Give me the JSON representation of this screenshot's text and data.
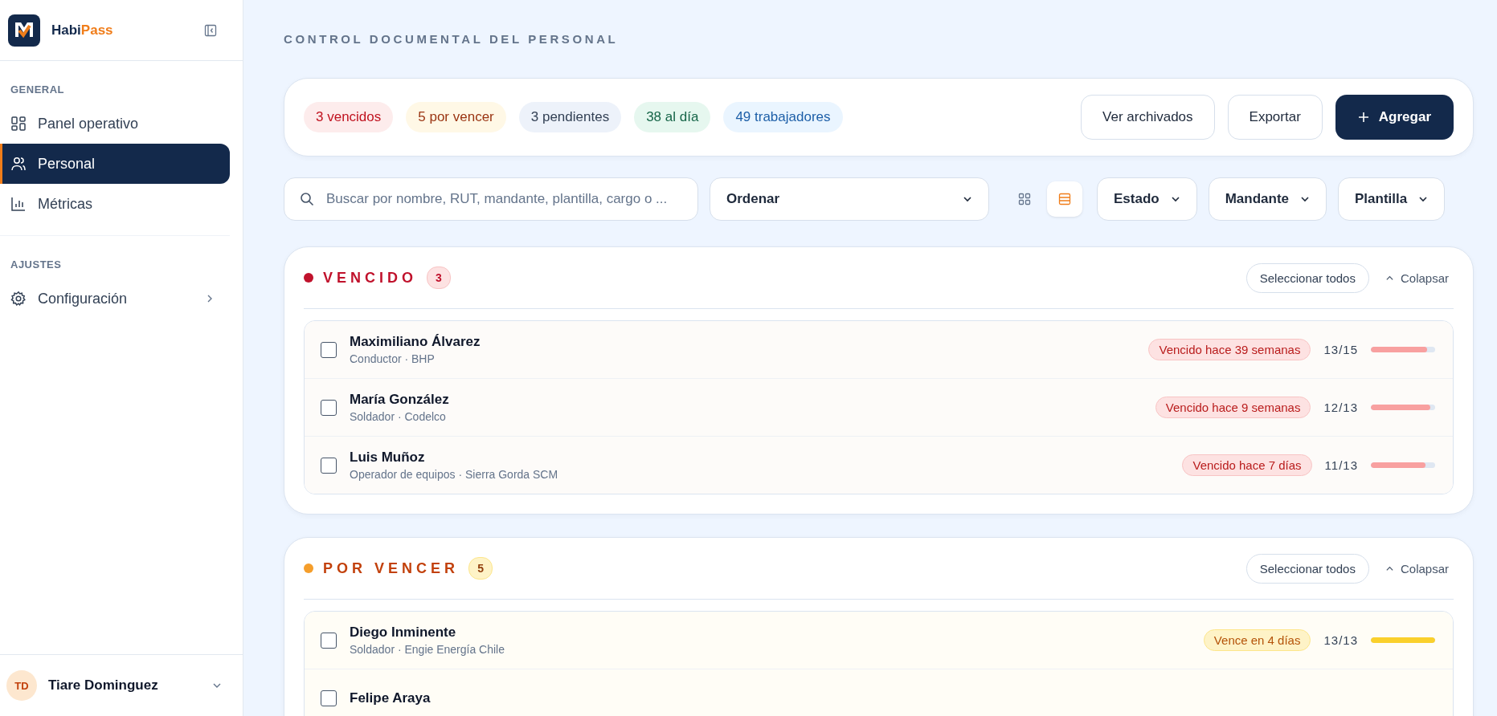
{
  "brand": {
    "name_part_1": "Habi",
    "name_part_2": "Pass"
  },
  "sidebar": {
    "sections": [
      {
        "heading": "GENERAL",
        "items": [
          {
            "label": "Panel operativo",
            "selected": false,
            "expandable": false
          },
          {
            "label": "Personal",
            "selected": true,
            "expandable": false
          },
          {
            "label": "Métricas",
            "selected": false,
            "expandable": false
          }
        ]
      },
      {
        "heading": "AJUSTES",
        "items": [
          {
            "label": "Configuración",
            "selected": false,
            "expandable": true
          }
        ]
      }
    ],
    "user": {
      "initials": "TD",
      "name": "Tiare Dominguez"
    }
  },
  "page_title": "CONTROL DOCUMENTAL DEL PERSONAL",
  "summary": {
    "chips": [
      {
        "label": "3 vencidos",
        "kind": "vencido"
      },
      {
        "label": "5 por vencer",
        "kind": "por_vencer"
      },
      {
        "label": "3 pendientes",
        "kind": "pendiente"
      },
      {
        "label": "38 al día",
        "kind": "al_dia"
      },
      {
        "label": "49 trabajadores",
        "kind": "total"
      }
    ],
    "buttons": [
      {
        "label": "Ver archivados",
        "kind": "outline"
      },
      {
        "label": "Exportar",
        "kind": "outline"
      },
      {
        "label": "Agregar",
        "kind": "primary"
      }
    ]
  },
  "filters": {
    "search": {
      "placeholder": "Buscar por nombre, RUT, mandante, plantilla, cargo o ..."
    },
    "sort": {
      "value": "Ordenar"
    },
    "view_toggle": [
      {
        "selected": false
      },
      {
        "selected": true
      }
    ],
    "dropdowns": [
      "Estado",
      "Mandante",
      "Plantilla"
    ]
  },
  "groups": [
    {
      "title": "VENCIDO",
      "kind": "vencido",
      "count": "3",
      "select_all": "Seleccionar todos",
      "collapse": "Colapsar",
      "rows": [
        {
          "name": "Maximiliano Álvarez",
          "subtitle": "Conductor · BHP",
          "status": "Vencido hace 39 semanas",
          "progress": "13/15",
          "level": 0.88,
          "checked": false
        },
        {
          "name": "María González",
          "subtitle": "Soldador · Codelco",
          "status": "Vencido hace 9 semanas",
          "progress": "12/13",
          "level": 0.92,
          "checked": false
        },
        {
          "name": "Luis Muñoz",
          "subtitle": "Operador de equipos · Sierra Gorda SCM",
          "status": "Vencido hace 7 días",
          "progress": "11/13",
          "level": 0.85,
          "checked": false
        }
      ]
    },
    {
      "title": "POR VENCER",
      "kind": "por_vencer",
      "count": "5",
      "select_all": "Seleccionar todos",
      "collapse": "Colapsar",
      "rows": [
        {
          "name": "Diego Inminente",
          "subtitle": "Soldador · Engie Energía Chile",
          "status": "Vence en 4 días",
          "progress": "13/13",
          "level": 1,
          "checked": false
        },
        {
          "name": "Felipe Araya",
          "checked": false
        }
      ]
    }
  ]
}
